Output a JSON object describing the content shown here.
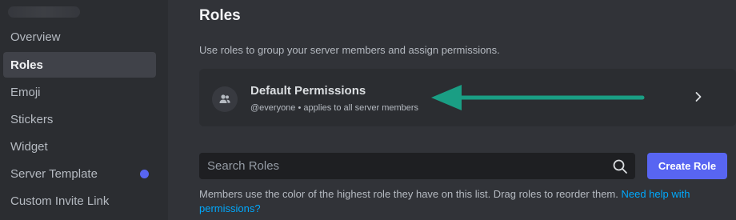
{
  "sidebar": {
    "items": [
      {
        "label": "Overview"
      },
      {
        "label": "Roles",
        "selected": true
      },
      {
        "label": "Emoji"
      },
      {
        "label": "Stickers"
      },
      {
        "label": "Widget"
      },
      {
        "label": "Server Template",
        "badge": "dot"
      },
      {
        "label": "Custom Invite Link"
      }
    ]
  },
  "main": {
    "title": "Roles",
    "description": "Use roles to group your server members and assign permissions.",
    "default_permissions": {
      "title": "Default Permissions",
      "subtitle": "@everyone • applies to all server members"
    },
    "search": {
      "placeholder": "Search Roles",
      "value": ""
    },
    "create_button_label": "Create Role",
    "help_text": "Members use the color of the highest role they have on this list. Drag roles to reorder them. ",
    "help_link": "Need help with permissions?"
  },
  "colors": {
    "accent": "#5865f2",
    "annotation_arrow": "#1a9e84",
    "link": "#00a8fc"
  },
  "icons": {
    "permissions": "people-icon",
    "chevron": "chevron-right-icon",
    "search": "search-icon"
  }
}
